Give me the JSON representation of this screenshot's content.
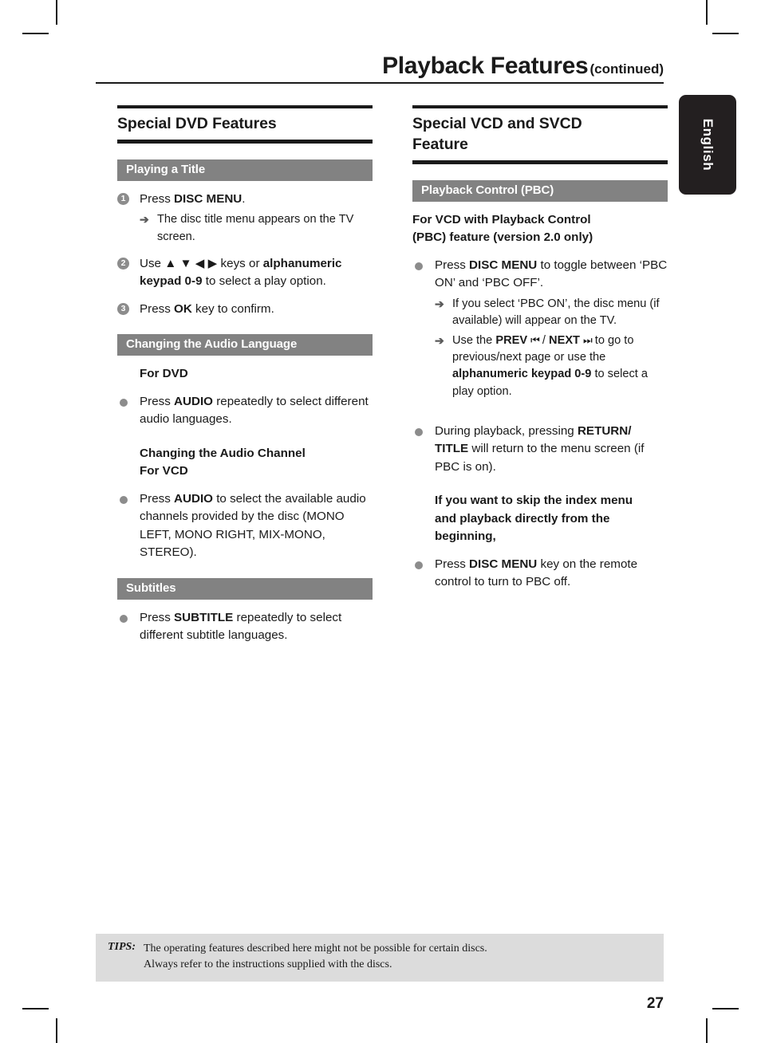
{
  "header": {
    "title": "Playback Features",
    "continued": "(continued)"
  },
  "lang_tab": {
    "label": "English"
  },
  "colors": {
    "bar_gray": "#828282",
    "badge_gray": "#8c8c8c",
    "tips_gray": "#dcdcdc",
    "tab_black": "#231f20",
    "rule_black": "#1a1a1a"
  },
  "left_column": {
    "section_title": "Special DVD Features",
    "bar_playing_title": "Playing a Title",
    "step1": {
      "number": "1",
      "text_pre": "Press ",
      "text_bold": "DISC MENU",
      "text_post": ".",
      "sub1_arrow": "➔",
      "sub1_text": "The disc title menu appears on the TV screen."
    },
    "step2": {
      "number": "2",
      "text_pre": "Use ",
      "keys": "▲ ▼ ◀ ▶",
      "text_mid": " keys or ",
      "text_bold": "alphanumeric keypad 0-9",
      "text_post": " to select a play option."
    },
    "step3": {
      "number": "3",
      "text_pre": "Press ",
      "text_bold": "OK",
      "text_post": " key to confirm."
    },
    "bar_audio_language": "Changing the Audio Language",
    "for_dvd_heading": "For DVD",
    "dvd_bullet": {
      "text_pre": "Press ",
      "text_bold": "AUDIO",
      "text_post": " repeatedly to select different audio languages."
    },
    "audio_channel_heading_line1": "Changing the Audio Channel",
    "audio_channel_heading_line2": "For VCD",
    "vcd_bullet": {
      "text_pre": "Press ",
      "text_bold": "AUDIO",
      "text_post": " to select the available audio channels provided by the disc (MONO LEFT, MONO RIGHT, MIX-MONO, STEREO)."
    },
    "bar_subtitles": "Subtitles",
    "subtitle_bullet": {
      "text_pre": "Press ",
      "text_bold": "SUBTITLE",
      "text_post": " repeatedly to select different subtitle languages."
    }
  },
  "right_column": {
    "section_title_line1": "Special VCD and SVCD",
    "section_title_line2": "Feature",
    "bar_pbc": "Playback Control (PBC)",
    "pbc_heading_line1": "For VCD with Playback Control",
    "pbc_heading_line2": "(PBC) feature (version 2.0 only)",
    "bullet1": {
      "text_pre": "Press ",
      "text_bold": "DISC MENU",
      "text_post": " to toggle between ‘PBC ON’ and ‘PBC OFF’.",
      "sub1_arrow": "➔",
      "sub1_text": "If you select ‘PBC ON’, the disc menu (if available) will appear on the TV.",
      "sub2_arrow": "➔",
      "sub2_pre": "Use the ",
      "sub2_prev": "PREV",
      "sub2_prev_glyph": "⏮",
      "sub2_sep": " / ",
      "sub2_next": "NEXT",
      "sub2_next_glyph": "⏭",
      "sub2_mid": " to go to previous/next page or use the ",
      "sub2_bold": "alphanumeric keypad 0-9",
      "sub2_post": " to select a play option."
    },
    "bullet2": {
      "text_pre": "During playback, pressing ",
      "text_bold": "RETURN/ TITLE",
      "text_post": " will return to the menu screen (if PBC is on)."
    },
    "skip_heading_line1": "If you want to skip the index menu",
    "skip_heading_line2": "and playback directly from the",
    "skip_heading_line3": "beginning,",
    "bullet3": {
      "text_pre": "Press ",
      "text_bold": "DISC MENU",
      "text_post": " key on the remote control to turn to PBC off."
    }
  },
  "footer": {
    "tips_label": "TIPS:",
    "tips_line1": "The operating features described here might not be possible for certain discs.",
    "tips_line2": "Always refer to the instructions supplied with the discs.",
    "page_number": "27"
  }
}
